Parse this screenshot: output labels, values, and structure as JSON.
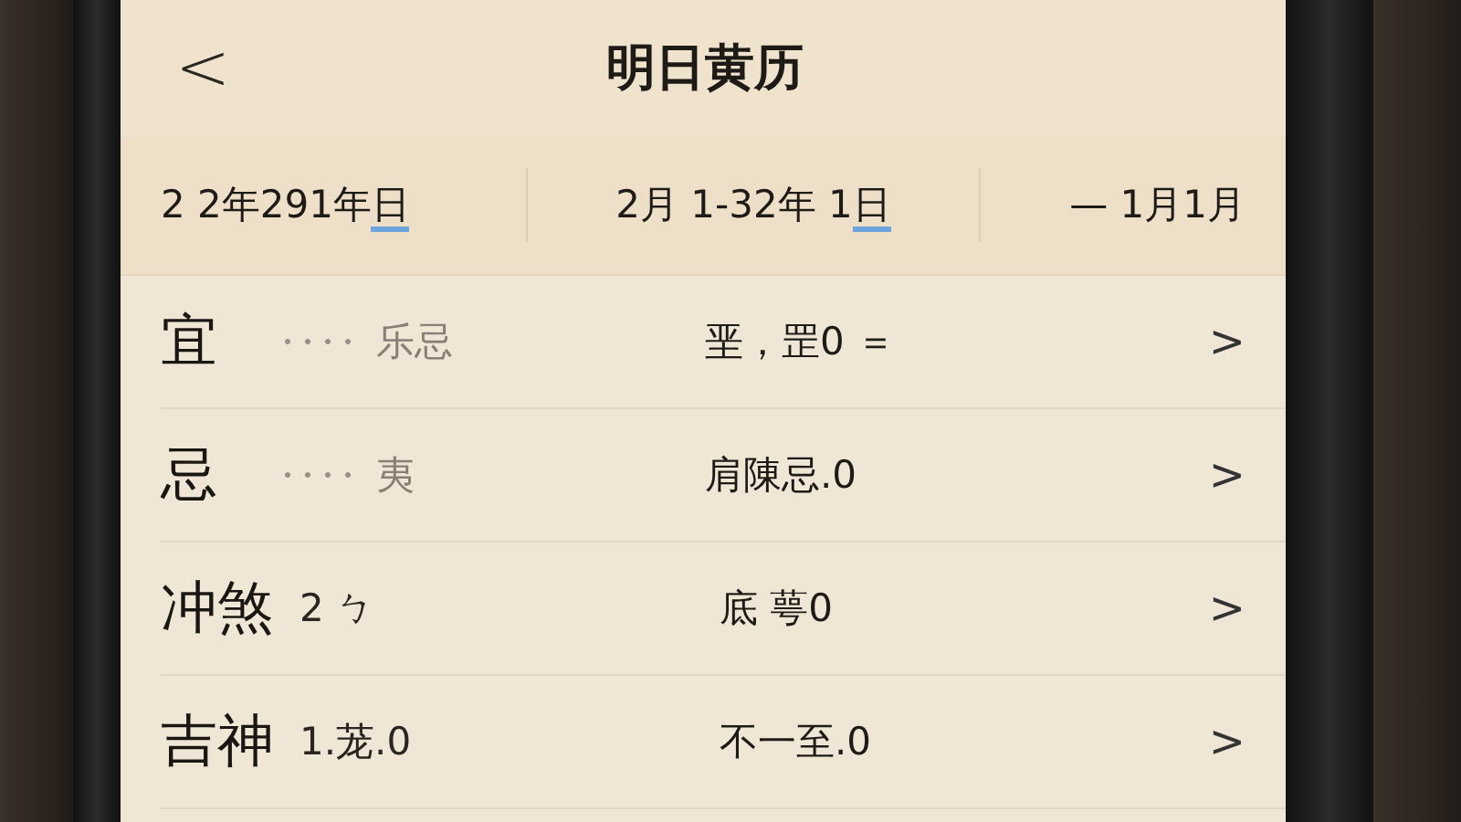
{
  "header": {
    "back": "<",
    "title": "明日黄历"
  },
  "dates": [
    {
      "text": "2 2年291年",
      "marked": "日"
    },
    {
      "text": "2月 1-32年 1",
      "marked": "日"
    },
    {
      "text": "— 1月1月"
    }
  ],
  "rows": [
    {
      "label": "宜",
      "dotted": true,
      "detail": "乐忌",
      "value": "垩，罡0 ＝",
      "chevron": ">"
    },
    {
      "label": "忌",
      "dotted": true,
      "detail": "夷",
      "value": "肩陳忌.0",
      "chevron": ">"
    },
    {
      "label": "冲煞",
      "dotted": false,
      "detail": "2 ㄅ",
      "value": "底  萼0",
      "chevron": ">"
    },
    {
      "label": "吉神",
      "dotted": false,
      "detail": "1.茏.0",
      "value": "不一至.0",
      "chevron": ">"
    }
  ]
}
